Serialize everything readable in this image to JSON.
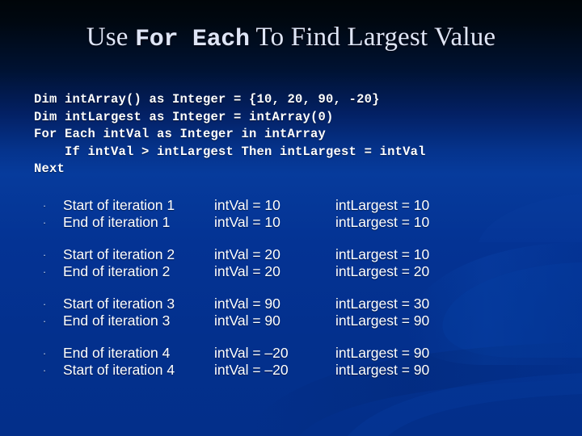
{
  "slide": {
    "title_parts": [
      {
        "text": "Use ",
        "style": "serif"
      },
      {
        "text": "For Each",
        "style": "mono"
      },
      {
        "text": " To Find Largest Value",
        "style": "serif"
      }
    ],
    "title_plain": "Use For Each To Find Largest Value",
    "background": {
      "top_color": "#000509",
      "mid_color": "#063b9c",
      "bottom_color": "#032f8a"
    },
    "text_color": "#ffffff",
    "title_color": "#dfe5f6",
    "bullet_glyph": "·"
  },
  "code": {
    "lines": [
      "Dim intArray() as Integer = {10, 20, 90, -20}",
      "Dim intLargest as Integer = intArray(0)",
      "For Each intVal as Integer in intArray",
      "    If intVal > intLargest Then intLargest = intVal",
      "Next"
    ]
  },
  "trace": {
    "groups": [
      {
        "rows": [
          {
            "label": "Start of iteration 1",
            "val": "intVal = 10",
            "largest": "intLargest = 10"
          },
          {
            "label": "End of iteration 1",
            "val": "intVal = 10",
            "largest": "intLargest = 10"
          }
        ]
      },
      {
        "rows": [
          {
            "label": "Start of iteration 2",
            "val": "intVal = 20",
            "largest": "intLargest = 10"
          },
          {
            "label": "End of iteration 2",
            "val": "intVal = 20",
            "largest": "intLargest = 20"
          }
        ]
      },
      {
        "rows": [
          {
            "label": "Start of iteration 3",
            "val": "intVal = 90",
            "largest": "intLargest = 30"
          },
          {
            "label": "End of iteration 3",
            "val": "intVal = 90",
            "largest": "intLargest = 90"
          }
        ]
      },
      {
        "rows": [
          {
            "label": "End of iteration 4",
            "val": "intVal = –20",
            "largest": "intLargest = 90"
          },
          {
            "label": "Start of iteration 4",
            "val": "intVal = –20",
            "largest": "intLargest = 90"
          }
        ]
      }
    ]
  }
}
